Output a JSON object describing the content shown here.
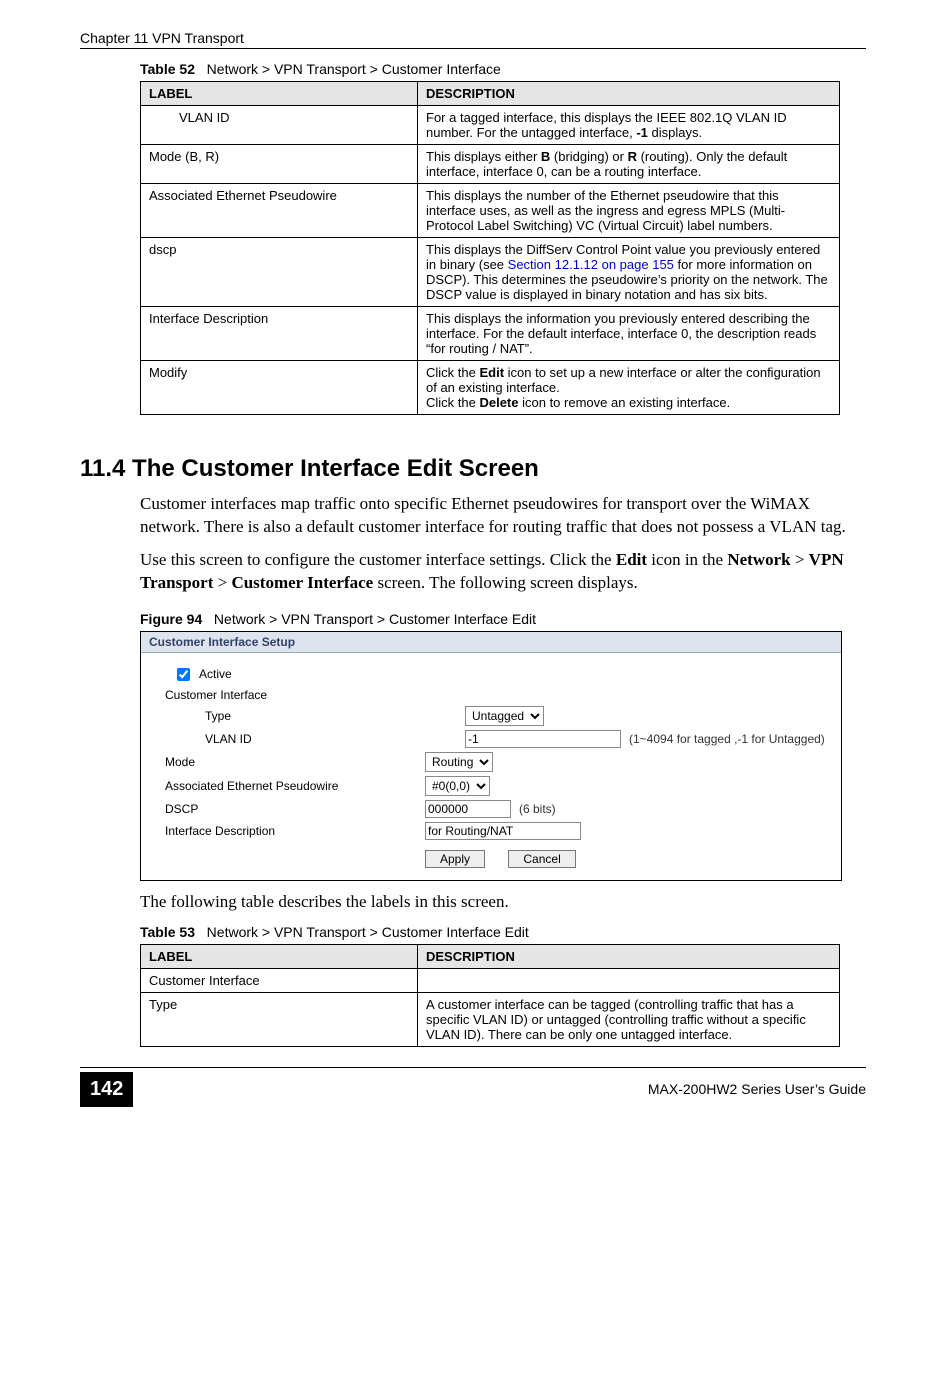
{
  "header": {
    "chapter": "Chapter 11 VPN Transport"
  },
  "footer": {
    "page": "142",
    "guide": "MAX-200HW2 Series User’s Guide"
  },
  "table52": {
    "caption_prefix": "Table 52",
    "caption": "Network > VPN Transport > Customer Interface",
    "head": {
      "label": "LABEL",
      "desc": "DESCRIPTION"
    },
    "rows": [
      {
        "label": "VLAN ID",
        "indent": true,
        "desc_parts": [
          "For a tagged interface, this displays the IEEE 802.1Q VLAN ID number. For the untagged interface, ",
          "-1",
          " displays."
        ]
      },
      {
        "label": "Mode (B, R)",
        "desc_parts": [
          "This displays either ",
          "B",
          " (bridging) or ",
          "R",
          " (routing). Only the default interface, interface 0, can be a routing interface."
        ]
      },
      {
        "label": "Associated Ethernet Pseudowire",
        "desc": "This displays the number of the Ethernet pseudowire that this interface uses, as well as the ingress and egress MPLS (Multi-Protocol Label Switching) VC (Virtual Circuit) label numbers."
      },
      {
        "label": "dscp",
        "desc_pre": "This displays the DiffServ Control Point value you previously entered in binary (see ",
        "desc_link": "Section 12.1.12 on page 155",
        "desc_post": " for more information on DSCP). This determines the pseudowire’s priority on the network. The DSCP value is displayed in binary notation and has six bits."
      },
      {
        "label": "Interface Description",
        "desc": "This displays the information you previously entered describing the interface. For the default interface, interface 0, the description reads “for routing / NAT”."
      },
      {
        "label": "Modify",
        "desc_parts2": [
          "Click the ",
          "Edit",
          " icon to set up a new interface or alter the configuration of an existing interface.",
          "Click the ",
          "Delete",
          " icon to remove an existing interface."
        ]
      }
    ]
  },
  "section": {
    "title": "11.4  The Customer Interface Edit Screen",
    "p1": "Customer interfaces map traffic onto specific Ethernet pseudowires for transport over the WiMAX network. There is also a default customer interface for routing traffic that does not possess a VLAN tag.",
    "p2_pre": "Use this screen to configure the customer interface settings. Click the ",
    "p2_b1": "Edit",
    "p2_mid1": " icon in the ",
    "p2_b2": "Network",
    "p2_mid2": " > ",
    "p2_b3": "VPN Transport",
    "p2_mid3": " > ",
    "p2_b4": "Customer Interface",
    "p2_post": " screen. The following screen displays."
  },
  "figure94": {
    "caption_prefix": "Figure 94",
    "caption": "Network > VPN Transport > Customer Interface Edit",
    "titlebar": "Customer Interface Setup",
    "active_label": "Active",
    "ci_label": "Customer Interface",
    "fields": {
      "type": {
        "label": "Type",
        "value": "Untagged"
      },
      "vlan": {
        "label": "VLAN ID",
        "value": "-1",
        "note": "(1~4094 for tagged ,-1 for Untagged)"
      },
      "mode": {
        "label": "Mode",
        "value": "Routing"
      },
      "assoc": {
        "label": "Associated Ethernet Pseudowire",
        "value": "#0(0,0)"
      },
      "dscp": {
        "label": "DSCP",
        "value": "000000",
        "note": "(6 bits)"
      },
      "ifdesc": {
        "label": "Interface Description",
        "value": "for Routing/NAT"
      }
    },
    "buttons": {
      "apply": "Apply",
      "cancel": "Cancel"
    }
  },
  "between_text": "The following table describes the labels in this screen.",
  "table53": {
    "caption_prefix": "Table 53",
    "caption": "Network > VPN Transport > Customer Interface Edit",
    "head": {
      "label": "LABEL",
      "desc": "DESCRIPTION"
    },
    "rows": [
      {
        "label": "Customer Interface",
        "desc": ""
      },
      {
        "label": "Type",
        "desc": "A customer interface can be tagged (controlling traffic that has a specific VLAN ID) or untagged (controlling traffic without a specific VLAN ID). There can be only one untagged interface."
      }
    ]
  }
}
